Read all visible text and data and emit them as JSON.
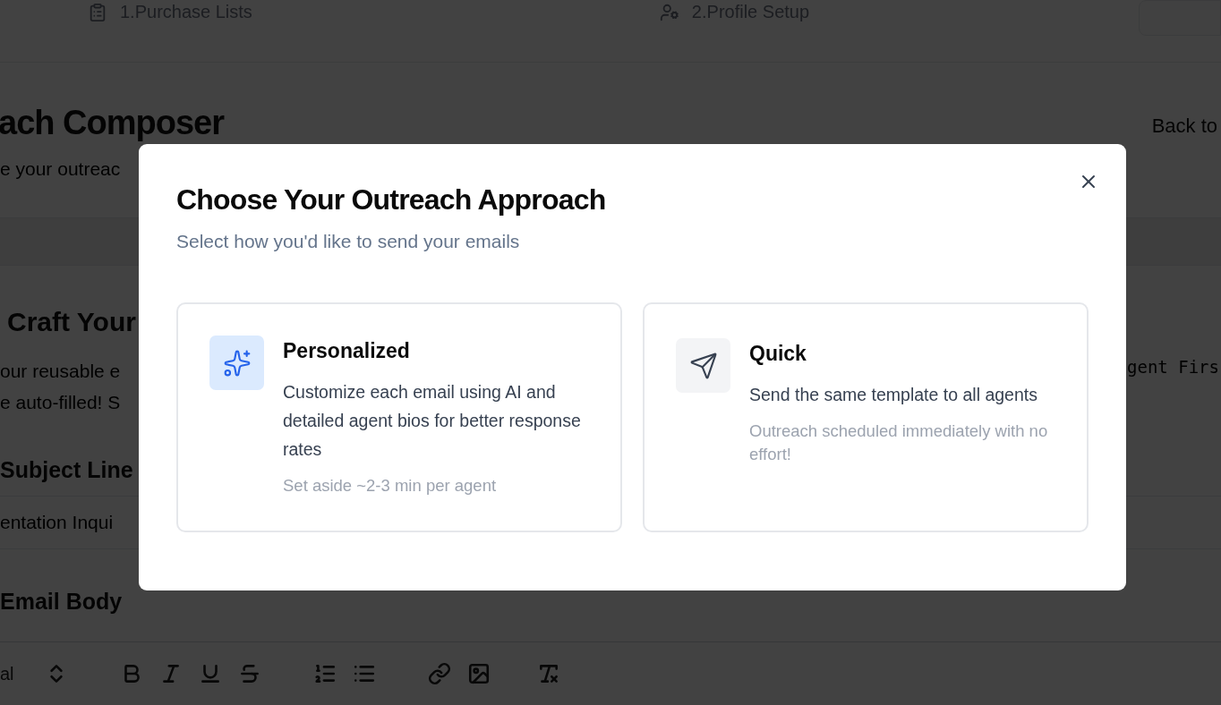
{
  "steps": [
    {
      "label": "1.Purchase Lists"
    },
    {
      "label": "2.Profile Setup"
    }
  ],
  "header": {
    "title": "ach Composer",
    "subtitle": "e your outreac",
    "back": "Back to"
  },
  "section": {
    "title": "Craft Your",
    "lines": [
      "our reusable e",
      "e auto-filled! S"
    ],
    "token": "gent Firs"
  },
  "subject": {
    "label": "Subject Line",
    "value": "entation Inqui"
  },
  "body": {
    "label": "Email Body",
    "font": "al",
    "tools": [
      {
        "kind": "updown"
      },
      {
        "kind": "bold"
      },
      {
        "kind": "italic"
      },
      {
        "kind": "underline"
      },
      {
        "kind": "strike"
      },
      {
        "kind": "ordered"
      },
      {
        "kind": "bullets"
      },
      {
        "kind": "link"
      },
      {
        "kind": "image"
      },
      {
        "kind": "clear"
      }
    ]
  },
  "modal": {
    "title": "Choose Your Outreach Approach",
    "subtitle": "Select how you'd like to send your emails",
    "options": [
      {
        "kind": "personalized",
        "title": "Personalized",
        "description": "Customize each email using AI and detailed agent bios for better response rates",
        "note": "Set aside ~2-3 min per agent"
      },
      {
        "kind": "quick",
        "title": "Quick",
        "description": "Send the same template to all agents",
        "note": "Outreach scheduled immediately with no effort!"
      }
    ]
  }
}
